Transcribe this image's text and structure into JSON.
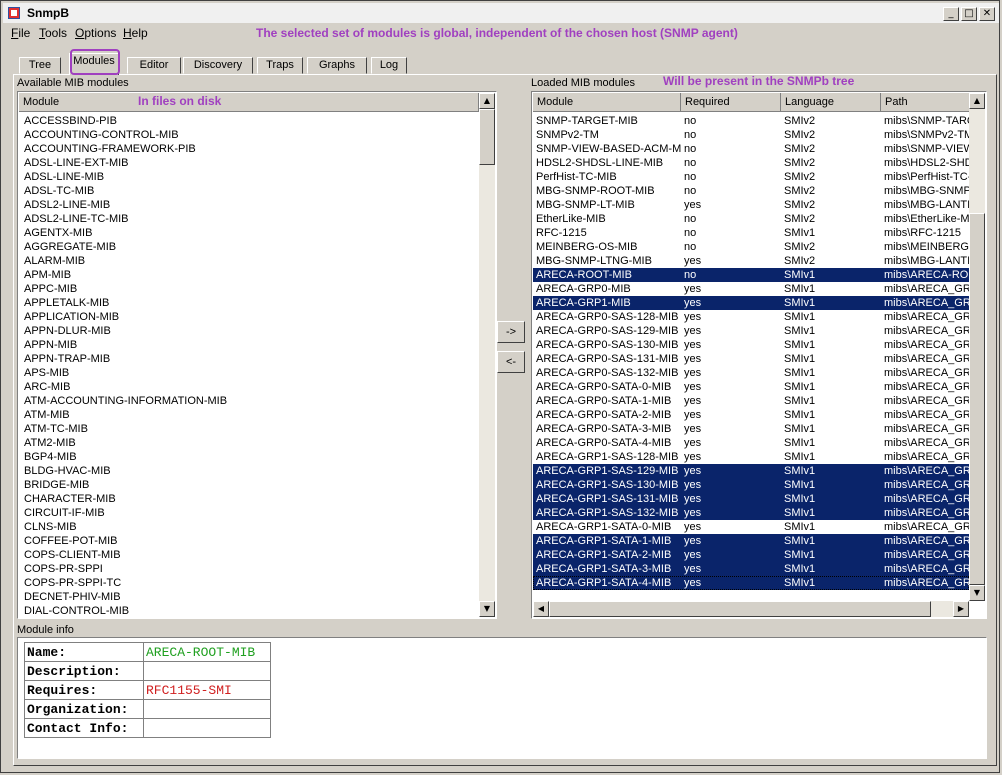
{
  "window": {
    "title": "SnmpB"
  },
  "menu": [
    "File",
    "Tools",
    "Options",
    "Help"
  ],
  "annotations": {
    "global_note": "The selected set of modules is global, independent of the chosen host (SNMP agent)",
    "files_note": "In files on disk",
    "tree_note": "Will be present in the SNMPb tree"
  },
  "tabs": [
    "Tree",
    "Modules",
    "Editor",
    "Discovery",
    "Traps",
    "Graphs",
    "Log"
  ],
  "active_tab": "Modules",
  "available": {
    "label": "Available MIB modules",
    "column": "Module",
    "items": [
      "ACCESSBIND-PIB",
      "ACCOUNTING-CONTROL-MIB",
      "ACCOUNTING-FRAMEWORK-PIB",
      "ADSL-LINE-EXT-MIB",
      "ADSL-LINE-MIB",
      "ADSL-TC-MIB",
      "ADSL2-LINE-MIB",
      "ADSL2-LINE-TC-MIB",
      "AGENTX-MIB",
      "AGGREGATE-MIB",
      "ALARM-MIB",
      "APM-MIB",
      "APPC-MIB",
      "APPLETALK-MIB",
      "APPLICATION-MIB",
      "APPN-DLUR-MIB",
      "APPN-MIB",
      "APPN-TRAP-MIB",
      "APS-MIB",
      "ARC-MIB",
      "ATM-ACCOUNTING-INFORMATION-MIB",
      "ATM-MIB",
      "ATM-TC-MIB",
      "ATM2-MIB",
      "BGP4-MIB",
      "BLDG-HVAC-MIB",
      "BRIDGE-MIB",
      "CHARACTER-MIB",
      "CIRCUIT-IF-MIB",
      "CLNS-MIB",
      "COFFEE-POT-MIB",
      "COPS-CLIENT-MIB",
      "COPS-PR-SPPI",
      "COPS-PR-SPPI-TC",
      "DECNET-PHIV-MIB",
      "DIAL-CONTROL-MIB"
    ]
  },
  "buttons": {
    "add": "->",
    "remove": "<-"
  },
  "loaded": {
    "label": "Loaded MIB modules",
    "columns": [
      "Module",
      "Required",
      "Language",
      "Path"
    ],
    "rows": [
      {
        "module": "SNMP-TARGET-MIB",
        "required": "no",
        "language": "SMIv2",
        "path": "mibs\\SNMP-TARG...",
        "selected": false
      },
      {
        "module": "SNMPv2-TM",
        "required": "no",
        "language": "SMIv2",
        "path": "mibs\\SNMPv2-TM",
        "selected": false
      },
      {
        "module": "SNMP-VIEW-BASED-ACM-MIB",
        "required": "no",
        "language": "SMIv2",
        "path": "mibs\\SNMP-VIEW...",
        "selected": false
      },
      {
        "module": "HDSL2-SHDSL-LINE-MIB",
        "required": "no",
        "language": "SMIv2",
        "path": "mibs\\HDSL2-SHD...",
        "selected": false
      },
      {
        "module": "PerfHist-TC-MIB",
        "required": "no",
        "language": "SMIv2",
        "path": "mibs\\PerfHist-TC-...",
        "selected": false
      },
      {
        "module": "MBG-SNMP-ROOT-MIB",
        "required": "no",
        "language": "SMIv2",
        "path": "mibs\\MBG-SNMP-...",
        "selected": false
      },
      {
        "module": "MBG-SNMP-LT-MIB",
        "required": "yes",
        "language": "SMIv2",
        "path": "mibs\\MBG-LANTI...",
        "selected": false
      },
      {
        "module": "EtherLike-MIB",
        "required": "no",
        "language": "SMIv2",
        "path": "mibs\\EtherLike-MI",
        "selected": false
      },
      {
        "module": "RFC-1215",
        "required": "no",
        "language": "SMIv1",
        "path": "mibs\\RFC-1215",
        "selected": false
      },
      {
        "module": "MEINBERG-OS-MIB",
        "required": "no",
        "language": "SMIv2",
        "path": "mibs\\MEINBERG-...",
        "selected": false
      },
      {
        "module": "MBG-SNMP-LTNG-MIB",
        "required": "yes",
        "language": "SMIv2",
        "path": "mibs\\MBG-LANTI...",
        "selected": false
      },
      {
        "module": "ARECA-ROOT-MIB",
        "required": "no",
        "language": "SMIv1",
        "path": "mibs\\ARECA-RO...",
        "selected": true
      },
      {
        "module": "ARECA-GRP0-MIB",
        "required": "yes",
        "language": "SMIv1",
        "path": "mibs\\ARECA_GR...",
        "selected": false
      },
      {
        "module": "ARECA-GRP1-MIB",
        "required": "yes",
        "language": "SMIv1",
        "path": "mibs\\ARECA_GR...",
        "selected": true
      },
      {
        "module": "ARECA-GRP0-SAS-128-MIB",
        "required": "yes",
        "language": "SMIv1",
        "path": "mibs\\ARECA_GR...",
        "selected": false
      },
      {
        "module": "ARECA-GRP0-SAS-129-MIB",
        "required": "yes",
        "language": "SMIv1",
        "path": "mibs\\ARECA_GR...",
        "selected": false
      },
      {
        "module": "ARECA-GRP0-SAS-130-MIB",
        "required": "yes",
        "language": "SMIv1",
        "path": "mibs\\ARECA_GR...",
        "selected": false
      },
      {
        "module": "ARECA-GRP0-SAS-131-MIB",
        "required": "yes",
        "language": "SMIv1",
        "path": "mibs\\ARECA_GR...",
        "selected": false
      },
      {
        "module": "ARECA-GRP0-SAS-132-MIB",
        "required": "yes",
        "language": "SMIv1",
        "path": "mibs\\ARECA_GR...",
        "selected": false
      },
      {
        "module": "ARECA-GRP0-SATA-0-MIB",
        "required": "yes",
        "language": "SMIv1",
        "path": "mibs\\ARECA_GR...",
        "selected": false
      },
      {
        "module": "ARECA-GRP0-SATA-1-MIB",
        "required": "yes",
        "language": "SMIv1",
        "path": "mibs\\ARECA_GR...",
        "selected": false
      },
      {
        "module": "ARECA-GRP0-SATA-2-MIB",
        "required": "yes",
        "language": "SMIv1",
        "path": "mibs\\ARECA_GR...",
        "selected": false
      },
      {
        "module": "ARECA-GRP0-SATA-3-MIB",
        "required": "yes",
        "language": "SMIv1",
        "path": "mibs\\ARECA_GR...",
        "selected": false
      },
      {
        "module": "ARECA-GRP0-SATA-4-MIB",
        "required": "yes",
        "language": "SMIv1",
        "path": "mibs\\ARECA_GR...",
        "selected": false
      },
      {
        "module": "ARECA-GRP1-SAS-128-MIB",
        "required": "yes",
        "language": "SMIv1",
        "path": "mibs\\ARECA_GR...",
        "selected": false
      },
      {
        "module": "ARECA-GRP1-SAS-129-MIB",
        "required": "yes",
        "language": "SMIv1",
        "path": "mibs\\ARECA_GR...",
        "selected": true
      },
      {
        "module": "ARECA-GRP1-SAS-130-MIB",
        "required": "yes",
        "language": "SMIv1",
        "path": "mibs\\ARECA_GR...",
        "selected": true
      },
      {
        "module": "ARECA-GRP1-SAS-131-MIB",
        "required": "yes",
        "language": "SMIv1",
        "path": "mibs\\ARECA_GR...",
        "selected": true
      },
      {
        "module": "ARECA-GRP1-SAS-132-MIB",
        "required": "yes",
        "language": "SMIv1",
        "path": "mibs\\ARECA_GR...",
        "selected": true
      },
      {
        "module": "ARECA-GRP1-SATA-0-MIB",
        "required": "yes",
        "language": "SMIv1",
        "path": "mibs\\ARECA_GR...",
        "selected": false
      },
      {
        "module": "ARECA-GRP1-SATA-1-MIB",
        "required": "yes",
        "language": "SMIv1",
        "path": "mibs\\ARECA_GR...",
        "selected": true
      },
      {
        "module": "ARECA-GRP1-SATA-2-MIB",
        "required": "yes",
        "language": "SMIv1",
        "path": "mibs\\ARECA_GR...",
        "selected": true
      },
      {
        "module": "ARECA-GRP1-SATA-3-MIB",
        "required": "yes",
        "language": "SMIv1",
        "path": "mibs\\ARECA_GR...",
        "selected": true
      },
      {
        "module": "ARECA-GRP1-SATA-4-MIB",
        "required": "yes",
        "language": "SMIv1",
        "path": "mibs\\ARECA_GR...",
        "selected": true
      }
    ]
  },
  "module_info": {
    "label": "Module info",
    "fields": [
      {
        "key": "Name:",
        "value": "ARECA-ROOT-MIB",
        "color": "#20a020"
      },
      {
        "key": "Description:",
        "value": "",
        "color": "#000000"
      },
      {
        "key": "Requires:",
        "value": "RFC1155-SMI",
        "color": "#d02020"
      },
      {
        "key": "Organization:",
        "value": "",
        "color": "#000000"
      },
      {
        "key": "Contact Info:",
        "value": "",
        "color": "#000000"
      }
    ]
  },
  "colors": {
    "selection": "#0a246a",
    "annotation": "#a040c0"
  }
}
